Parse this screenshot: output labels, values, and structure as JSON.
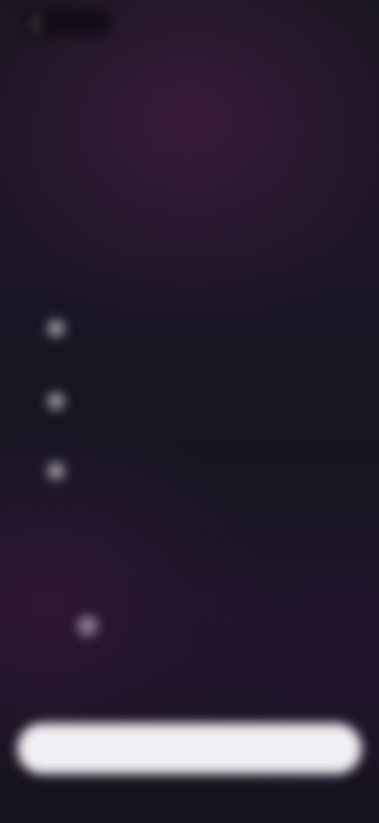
{
  "topbar": {
    "back_label": "",
    "right_link": ""
  },
  "header": {
    "title": "",
    "subtitle": ""
  },
  "benefits": [
    {
      "icon": "check-icon",
      "text": ""
    },
    {
      "icon": "check-icon",
      "text": ""
    },
    {
      "icon": "check-icon",
      "text": ""
    }
  ],
  "consent": {
    "text": ""
  },
  "cta": {
    "label": ""
  },
  "colors": {
    "background": "#141320",
    "accent_purple": "#3e1c3e",
    "button": "#f1eff3"
  }
}
